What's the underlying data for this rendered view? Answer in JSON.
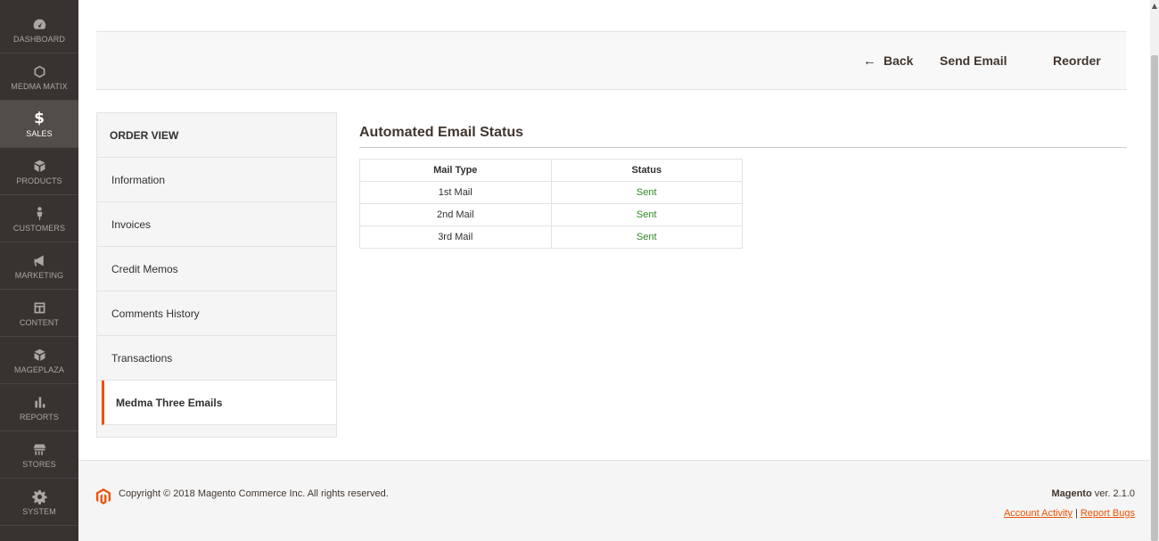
{
  "menu": {
    "items": [
      {
        "label": "DASHBOARD",
        "icon": "dashboard-icon"
      },
      {
        "label": "MEDMA MATIX",
        "icon": "hexagon-icon"
      },
      {
        "label": "SALES",
        "icon": "dollar-icon"
      },
      {
        "label": "PRODUCTS",
        "icon": "box-icon"
      },
      {
        "label": "CUSTOMERS",
        "icon": "person-icon"
      },
      {
        "label": "MARKETING",
        "icon": "megaphone-icon"
      },
      {
        "label": "CONTENT",
        "icon": "layout-icon"
      },
      {
        "label": "MAGEPLAZA",
        "icon": "box-icon"
      },
      {
        "label": "REPORTS",
        "icon": "bar-chart-icon"
      },
      {
        "label": "STORES",
        "icon": "store-icon"
      },
      {
        "label": "SYSTEM",
        "icon": "gear-icon"
      }
    ],
    "sales_symbol": "$"
  },
  "actions": {
    "back_arrow": "←",
    "back_label": "Back",
    "send_email_label": "Send Email",
    "reorder_label": "Reorder"
  },
  "tabs": {
    "title": "ORDER VIEW",
    "items": [
      "Information",
      "Invoices",
      "Credit Memos",
      "Comments History",
      "Transactions",
      "Medma Three Emails"
    ]
  },
  "section": {
    "title": "Automated Email Status"
  },
  "table": {
    "headers": [
      "Mail Type",
      "Status"
    ],
    "rows": [
      {
        "type": "1st Mail",
        "status": "Sent"
      },
      {
        "type": "2nd Mail",
        "status": "Sent"
      },
      {
        "type": "3rd Mail",
        "status": "Sent"
      }
    ]
  },
  "footer": {
    "copyright": "Copyright © 2018 Magento Commerce Inc. All rights reserved.",
    "brand": "Magento",
    "version": " ver. 2.1.0",
    "account_activity": "Account Activity",
    "separator": "|",
    "report_bugs": "Report Bugs"
  },
  "colors": {
    "menu_bg": "#373330",
    "accent": "#eb5202",
    "status_sent": "#2e8a22"
  }
}
